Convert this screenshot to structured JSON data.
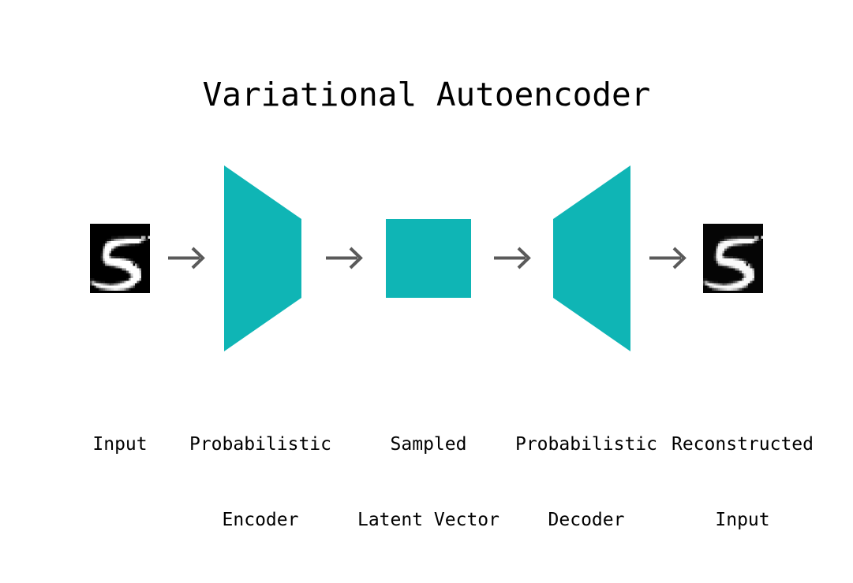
{
  "title": "Variational Autoencoder",
  "colors": {
    "background": "#ffffff",
    "teal": "#0fb5b5",
    "arrow": "#5a5a5a",
    "text": "#000000",
    "image_background": "#000000",
    "digit_stroke": "#ffffff"
  },
  "pipeline": {
    "nodes": [
      {
        "id": "input-image",
        "kind": "image",
        "digit": "5",
        "caption_lines": [
          "Input"
        ]
      },
      {
        "id": "encoder",
        "kind": "trapezoid-narrowing",
        "caption_lines": [
          "Probabilistic",
          "Encoder"
        ]
      },
      {
        "id": "latent",
        "kind": "square",
        "caption_lines": [
          "Sampled",
          "Latent Vector"
        ]
      },
      {
        "id": "decoder",
        "kind": "trapezoid-widening",
        "caption_lines": [
          "Probabilistic",
          "Decoder"
        ]
      },
      {
        "id": "output-image",
        "kind": "image",
        "digit": "5",
        "caption_lines": [
          "Reconstructed",
          "Input"
        ]
      }
    ],
    "arrows": [
      {
        "id": "arrow-input-to-encoder",
        "glyph": "arrow-right-icon"
      },
      {
        "id": "arrow-encoder-to-latent",
        "glyph": "arrow-right-icon"
      },
      {
        "id": "arrow-latent-to-decoder",
        "glyph": "arrow-right-icon"
      },
      {
        "id": "arrow-decoder-to-output",
        "glyph": "arrow-right-icon"
      }
    ]
  },
  "chart_data": {
    "type": "diagram",
    "title": "Variational Autoencoder",
    "stages": [
      "Input",
      "Probabilistic Encoder",
      "Sampled Latent Vector",
      "Probabilistic Decoder",
      "Reconstructed Input"
    ],
    "flow": "Input -> Probabilistic Encoder -> Sampled Latent Vector -> Probabilistic Decoder -> Reconstructed Input"
  }
}
